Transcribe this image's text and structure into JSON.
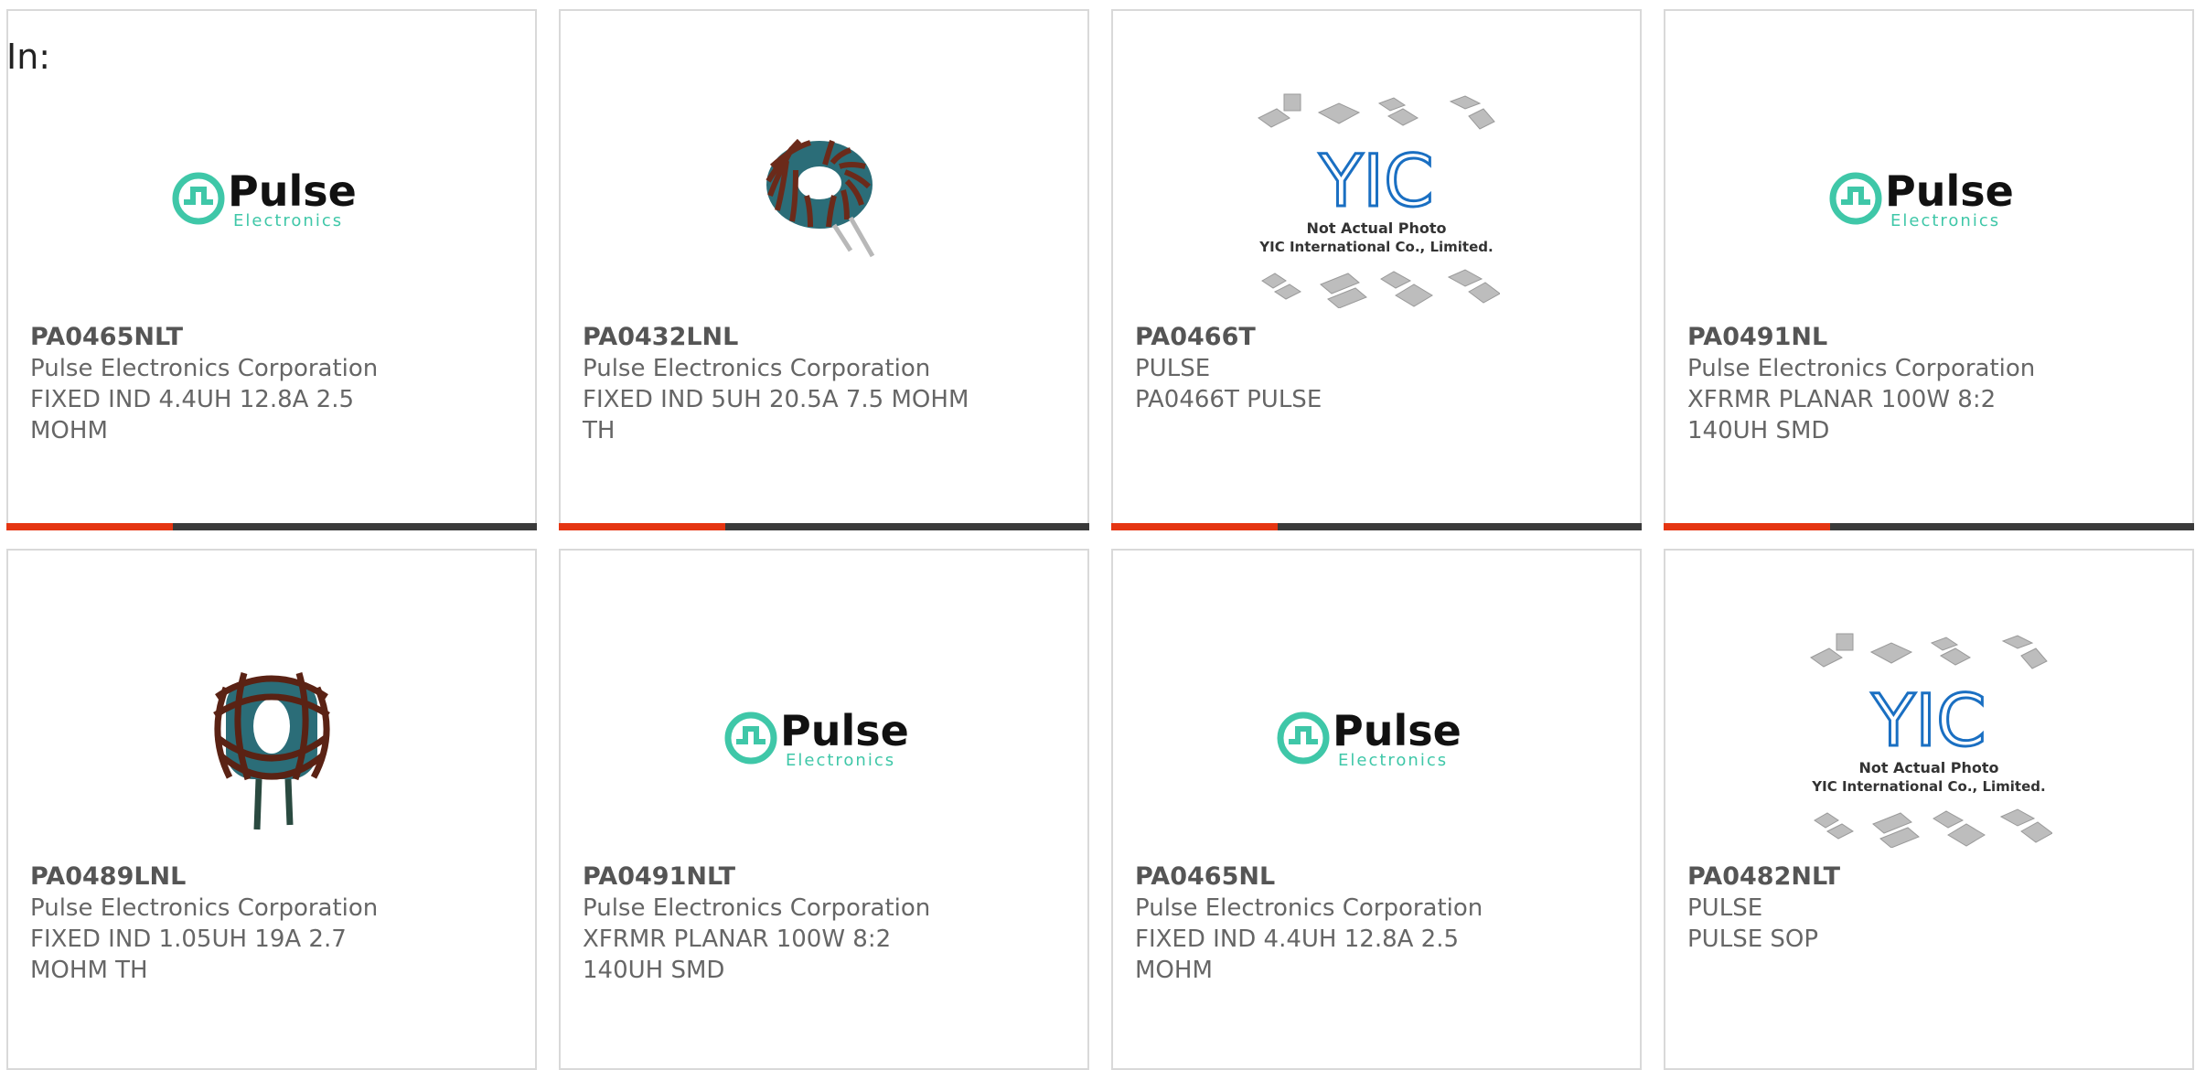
{
  "header": {
    "label": "In:"
  },
  "colors": {
    "accent_red": "#e53512",
    "accent_dark": "#3a3a3a",
    "pulse_teal": "#3fc7a8",
    "yic_blue": "#1a6fc2"
  },
  "logos": {
    "pulse_name": "Pulse",
    "pulse_sub": "Electronics",
    "yic_mark": "YIC",
    "yic_line1": "Not Actual Photo",
    "yic_line2": "YIC International Co., Limited."
  },
  "products": [
    {
      "part": "PA0465NLT",
      "manufacturer": "Pulse Electronics Corporation",
      "description": "FIXED IND 4.4UH 12.8A 2.5 MOHM",
      "image": "pulse-logo"
    },
    {
      "part": "PA0432LNL",
      "manufacturer": "Pulse Electronics Corporation",
      "description": "FIXED IND 5UH 20.5A 7.5 MOHM TH",
      "image": "toroid-inductor"
    },
    {
      "part": "PA0466T",
      "manufacturer": "PULSE",
      "description": "PA0466T PULSE",
      "image": "yic-not-actual-photo"
    },
    {
      "part": "PA0491NL",
      "manufacturer": "Pulse Electronics Corporation",
      "description": "XFRMR PLANAR 100W 8:2 140UH SMD",
      "image": "pulse-logo"
    },
    {
      "part": "PA0489LNL",
      "manufacturer": "Pulse Electronics Corporation",
      "description": "FIXED IND 1.05UH 19A 2.7 MOHM TH",
      "image": "toroid-inductor-vertical"
    },
    {
      "part": "PA0491NLT",
      "manufacturer": "Pulse Electronics Corporation",
      "description": "XFRMR PLANAR 100W 8:2 140UH SMD",
      "image": "pulse-logo"
    },
    {
      "part": "PA0465NL",
      "manufacturer": "Pulse Electronics Corporation",
      "description": "FIXED IND 4.4UH 12.8A 2.5 MOHM",
      "image": "pulse-logo"
    },
    {
      "part": "PA0482NLT",
      "manufacturer": "PULSE",
      "description": "PULSE SOP",
      "image": "yic-not-actual-photo"
    }
  ]
}
